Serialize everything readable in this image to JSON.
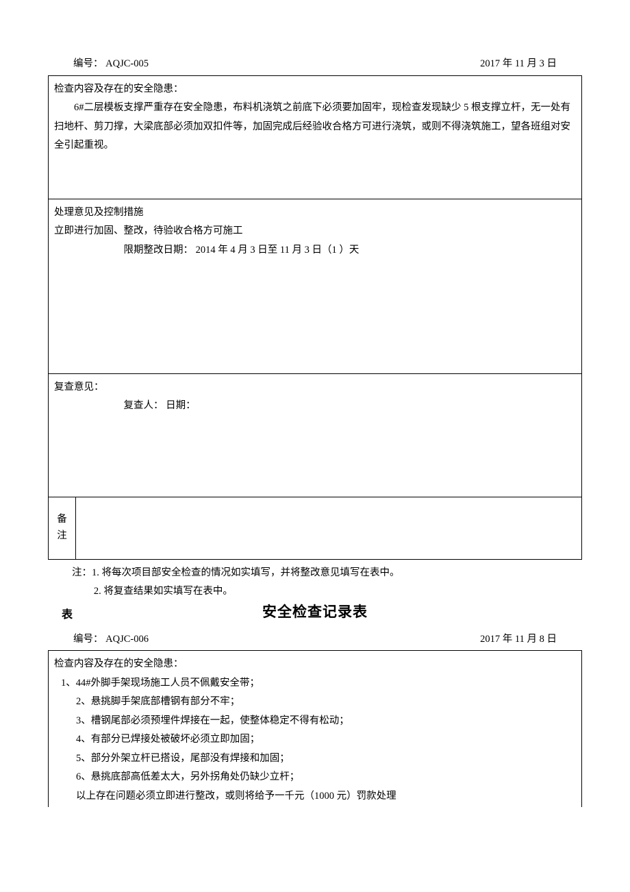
{
  "form1": {
    "header": {
      "numLabel": "编号：",
      "num": "AQJC-005",
      "date": "2017 年  11 月 3 日"
    },
    "inspect": {
      "title": "检查内容及存在的安全隐患：",
      "body": "6#二层模板支撑严重存在安全隐患，布料机浇筑之前底下必须要加固牢，现检查发现缺少 5 根支撑立杆，无一处有扫地杆、剪刀撑，大梁底部必须加双扣件等，加固完成后经验收合格方可进行浇筑，或则不得浇筑施工，望各班组对安全引起重视。"
    },
    "opinion": {
      "title": "处理意见及控制措施",
      "line1": "立即进行加固、整改，待验收合格方可施工",
      "deadline": "限期整改日期： 2014 年 4 月 3 日至  11 月 3 日（1 ）天"
    },
    "review": {
      "title": "复查意见：",
      "line": "复查人：                  日期："
    },
    "notesLabel1": "备",
    "notesLabel2": "注"
  },
  "footnotes": {
    "n1": "注：1. 将每次项目部安全检查的情况如实填写，并将整改意见填写在表中。",
    "n2": "2. 将复查结果如实填写在表中。"
  },
  "titleRow": {
    "left": "表",
    "center": "安全检查记录表"
  },
  "form2": {
    "header": {
      "numLabel": "编号：",
      "num": "AQJC-006",
      "date": "2017 年  11 月 8 日"
    },
    "inspect": {
      "title": "检查内容及存在的安全隐患：",
      "items": [
        "1、44#外脚手架现场施工人员不佩戴安全带；",
        "2、悬挑脚手架底部槽钢有部分不牢；",
        "3、槽钢尾部必须预埋件焊接在一起，使整体稳定不得有松动；",
        "4、有部分已焊接处被破坏必须立即加固；",
        "5、部分外架立杆已搭设，尾部没有焊接和加固；",
        "6、悬挑底部高低差太大，另外拐角处仍缺少立杆；"
      ],
      "footer": "以上存在问题必须立即进行整改，或则将给予一千元（1000 元）罚款处理"
    }
  }
}
